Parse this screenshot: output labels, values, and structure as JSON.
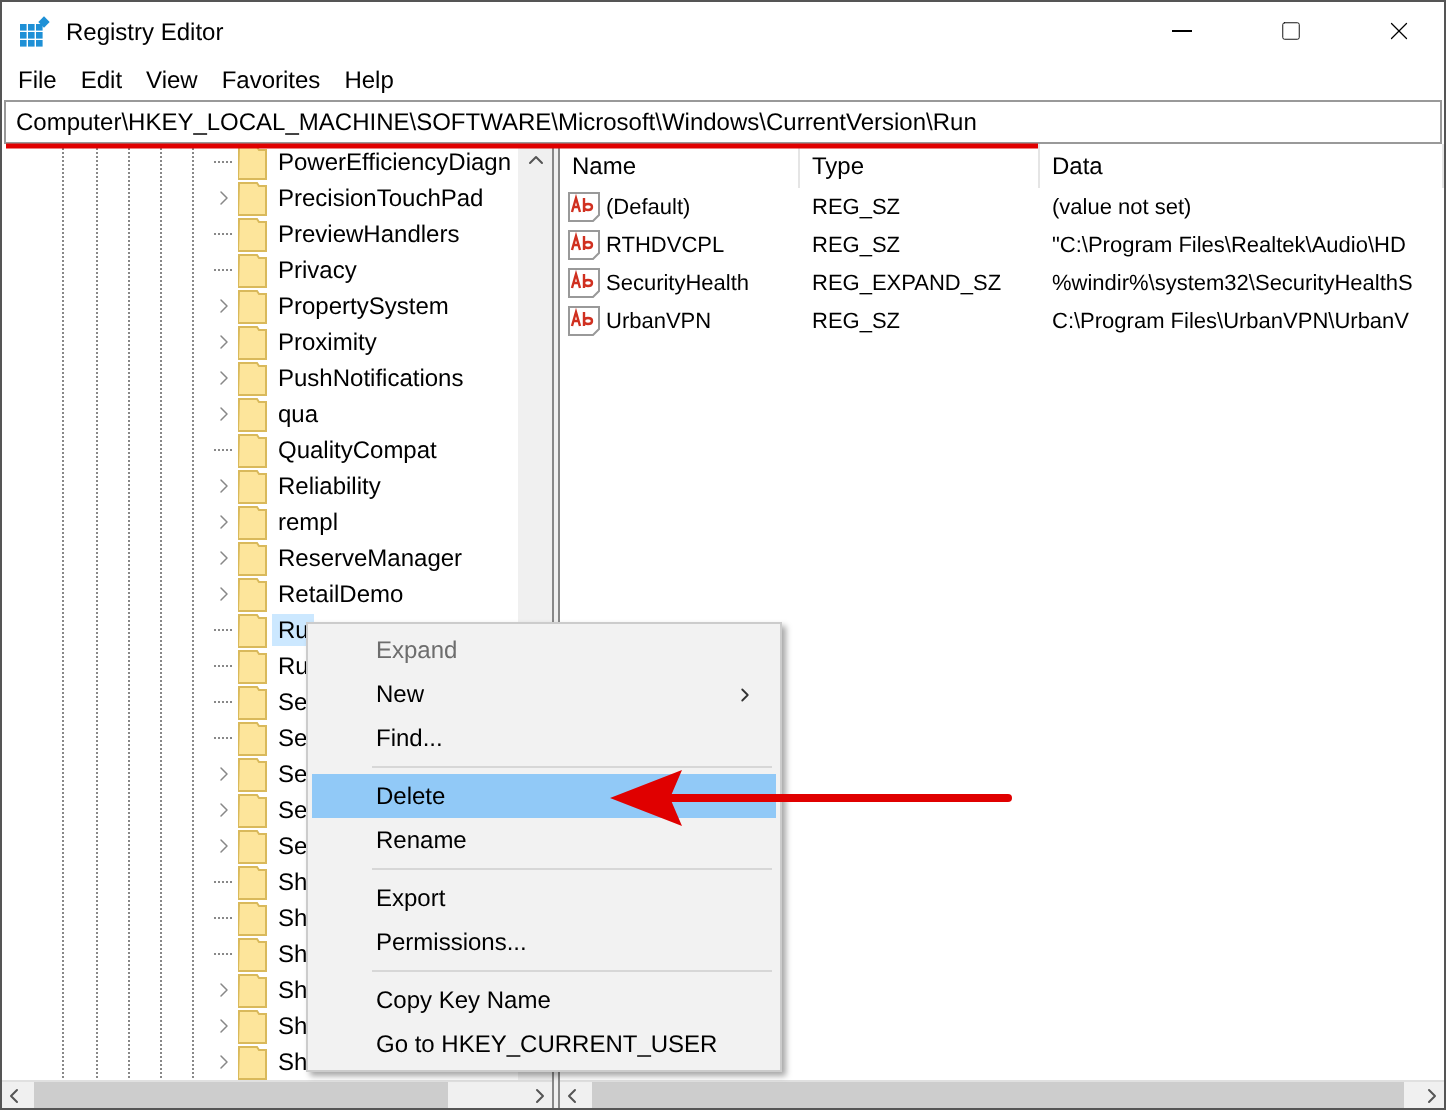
{
  "window": {
    "title": "Registry Editor"
  },
  "menu_bar": [
    "File",
    "Edit",
    "View",
    "Favorites",
    "Help"
  ],
  "address_bar": {
    "value": "Computer\\HKEY_LOCAL_MACHINE\\SOFTWARE\\Microsoft\\Windows\\CurrentVersion\\Run"
  },
  "tree": {
    "items": [
      {
        "label": "PowerEfficiencyDiagn",
        "expandable": false,
        "selected": false
      },
      {
        "label": "PrecisionTouchPad",
        "expandable": true,
        "selected": false
      },
      {
        "label": "PreviewHandlers",
        "expandable": false,
        "selected": false
      },
      {
        "label": "Privacy",
        "expandable": false,
        "selected": false
      },
      {
        "label": "PropertySystem",
        "expandable": true,
        "selected": false
      },
      {
        "label": "Proximity",
        "expandable": true,
        "selected": false
      },
      {
        "label": "PushNotifications",
        "expandable": true,
        "selected": false
      },
      {
        "label": "qua",
        "expandable": true,
        "selected": false
      },
      {
        "label": "QualityCompat",
        "expandable": false,
        "selected": false
      },
      {
        "label": "Reliability",
        "expandable": true,
        "selected": false
      },
      {
        "label": "rempl",
        "expandable": true,
        "selected": false
      },
      {
        "label": "ReserveManager",
        "expandable": true,
        "selected": false
      },
      {
        "label": "RetailDemo",
        "expandable": true,
        "selected": false
      },
      {
        "label": "Ru",
        "expandable": false,
        "selected": true
      },
      {
        "label": "Ru",
        "expandable": false,
        "selected": false
      },
      {
        "label": "Se",
        "expandable": false,
        "selected": false
      },
      {
        "label": "Se",
        "expandable": false,
        "selected": false
      },
      {
        "label": "Se",
        "expandable": true,
        "selected": false
      },
      {
        "label": "Se",
        "expandable": true,
        "selected": false
      },
      {
        "label": "Se",
        "expandable": true,
        "selected": false
      },
      {
        "label": "Sh",
        "expandable": false,
        "selected": false
      },
      {
        "label": "Sh",
        "expandable": false,
        "selected": false
      },
      {
        "label": "Sh",
        "expandable": false,
        "selected": false
      },
      {
        "label": "Sh",
        "expandable": true,
        "selected": false
      },
      {
        "label": "Sh",
        "expandable": true,
        "selected": false
      },
      {
        "label": "Sh",
        "expandable": true,
        "selected": false
      }
    ]
  },
  "values": {
    "columns": [
      "Name",
      "Type",
      "Data"
    ],
    "rows": [
      {
        "name": "(Default)",
        "type": "REG_SZ",
        "data": "(value not set)"
      },
      {
        "name": "RTHDVCPL",
        "type": "REG_SZ",
        "data": "\"C:\\Program Files\\Realtek\\Audio\\HD"
      },
      {
        "name": "SecurityHealth",
        "type": "REG_EXPAND_SZ",
        "data": "%windir%\\system32\\SecurityHealthS"
      },
      {
        "name": "UrbanVPN",
        "type": "REG_SZ",
        "data": "C:\\Program Files\\UrbanVPN\\UrbanV"
      }
    ]
  },
  "context_menu": {
    "items": [
      {
        "kind": "item",
        "label": "Expand",
        "disabled": true,
        "highlighted": false,
        "submenu": false
      },
      {
        "kind": "item",
        "label": "New",
        "disabled": false,
        "highlighted": false,
        "submenu": true
      },
      {
        "kind": "item",
        "label": "Find...",
        "disabled": false,
        "highlighted": false,
        "submenu": false
      },
      {
        "kind": "separator"
      },
      {
        "kind": "item",
        "label": "Delete",
        "disabled": false,
        "highlighted": true,
        "submenu": false
      },
      {
        "kind": "item",
        "label": "Rename",
        "disabled": false,
        "highlighted": false,
        "submenu": false
      },
      {
        "kind": "separator"
      },
      {
        "kind": "item",
        "label": "Export",
        "disabled": false,
        "highlighted": false,
        "submenu": false
      },
      {
        "kind": "item",
        "label": "Permissions...",
        "disabled": false,
        "highlighted": false,
        "submenu": false
      },
      {
        "kind": "separator"
      },
      {
        "kind": "item",
        "label": "Copy Key Name",
        "disabled": false,
        "highlighted": false,
        "submenu": false
      },
      {
        "kind": "item",
        "label": "Go to HKEY_CURRENT_USER",
        "disabled": false,
        "highlighted": false,
        "submenu": false
      }
    ]
  }
}
